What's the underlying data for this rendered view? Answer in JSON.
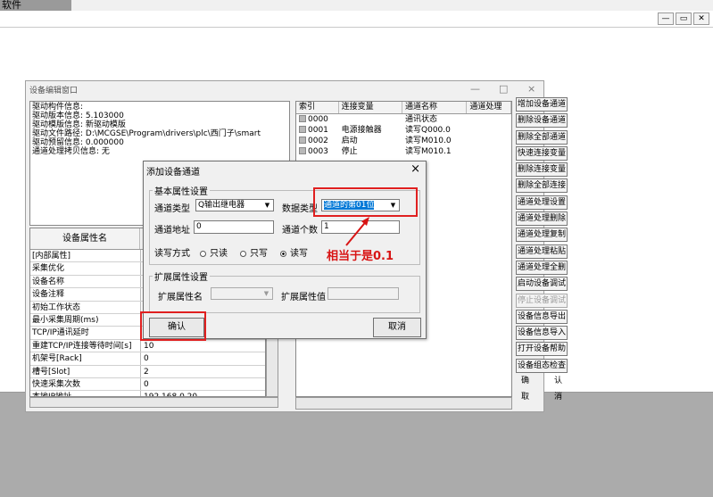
{
  "app": {
    "title_fragment": "软件"
  },
  "device_window": {
    "title": "设备编辑窗口",
    "controls": [
      "—",
      "□",
      "×"
    ],
    "info_lines": [
      "驱动构件信息:",
      "驱动版本信息: 5.103000",
      "驱动模版信息: 新驱动模版",
      "驱动文件路径: D:\\MCGSE\\Program\\drivers\\plc\\西门子\\smart",
      "驱动预留信息: 0.000000",
      "通道处理拷贝信息: 无"
    ],
    "props_header": [
      "设备属性名",
      ""
    ],
    "props": [
      {
        "k": "[内部属性]",
        "v": ""
      },
      {
        "k": "采集优化",
        "v": ""
      },
      {
        "k": "设备名称",
        "v": ""
      },
      {
        "k": "设备注释",
        "v": ""
      },
      {
        "k": "初始工作状态",
        "v": ""
      },
      {
        "k": "最小采集周期(ms)",
        "v": ""
      },
      {
        "k": "TCP/IP通讯延时",
        "v": ""
      },
      {
        "k": "重建TCP/IP连接等待时间[s]",
        "v": "10"
      },
      {
        "k": "机架号[Rack]",
        "v": "0"
      },
      {
        "k": "槽号[Slot]",
        "v": "2"
      },
      {
        "k": "快速采集次数",
        "v": "0"
      },
      {
        "k": "本地IP地址",
        "v": "192.168.0.20"
      }
    ],
    "channel_headers": [
      "索引",
      "连接变量",
      "通道名称",
      "通道处理"
    ],
    "channels": [
      {
        "idx": "0000",
        "var": "",
        "name": "通讯状态",
        "proc": ""
      },
      {
        "idx": "0001",
        "var": "电源接触器",
        "name": "读写Q000.0",
        "proc": ""
      },
      {
        "idx": "0002",
        "var": "启动",
        "name": "读写M010.0",
        "proc": ""
      },
      {
        "idx": "0003",
        "var": "停止",
        "name": "读写M010.1",
        "proc": ""
      }
    ],
    "side_buttons": [
      {
        "label": "增加设备通道",
        "enabled": true
      },
      {
        "label": "删除设备通道",
        "enabled": true
      },
      {
        "label": "删除全部通道",
        "enabled": true
      },
      {
        "label": "快速连接变量",
        "enabled": true
      },
      {
        "label": "删除连接变量",
        "enabled": true
      },
      {
        "label": "删除全部连接",
        "enabled": true
      },
      {
        "label": "通道处理设置",
        "enabled": true
      },
      {
        "label": "通道处理删除",
        "enabled": true
      },
      {
        "label": "通道处理复制",
        "enabled": true
      },
      {
        "label": "通道处理粘贴",
        "enabled": true
      },
      {
        "label": "通道处理全删",
        "enabled": true
      },
      {
        "label": "启动设备调试",
        "enabled": true
      },
      {
        "label": "停止设备调试",
        "enabled": false
      },
      {
        "label": "设备信息导出",
        "enabled": true
      },
      {
        "label": "设备信息导入",
        "enabled": true
      },
      {
        "label": "打开设备帮助",
        "enabled": true
      },
      {
        "label": "设备组态检查",
        "enabled": true
      }
    ],
    "confirm_pair": [
      "确",
      "认"
    ],
    "cancel_pair": [
      "取",
      "消"
    ]
  },
  "dialog": {
    "title": "添加设备通道",
    "close": "×",
    "basic_group": "基本属性设置",
    "channel_type_label": "通道类型",
    "channel_type_value": "Q输出继电器",
    "data_type_label": "数据类型",
    "data_type_value": "通道的第01位",
    "channel_addr_label": "通道地址",
    "channel_addr_value": "0",
    "channel_count_label": "通道个数",
    "channel_count_value": "1",
    "rw_label": "读写方式",
    "rw_options": [
      "只读",
      "只写",
      "读写"
    ],
    "rw_selected": "读写",
    "ext_group": "扩展属性设置",
    "ext_name_label": "扩展属性名",
    "ext_value_label": "扩展属性值",
    "ok": "确认",
    "cancel": "取消"
  },
  "annotation": {
    "text": "相当于是0.1",
    "color": "#d81414"
  },
  "colors": {
    "highlight": "#e02020",
    "selection": "#0078d7"
  }
}
